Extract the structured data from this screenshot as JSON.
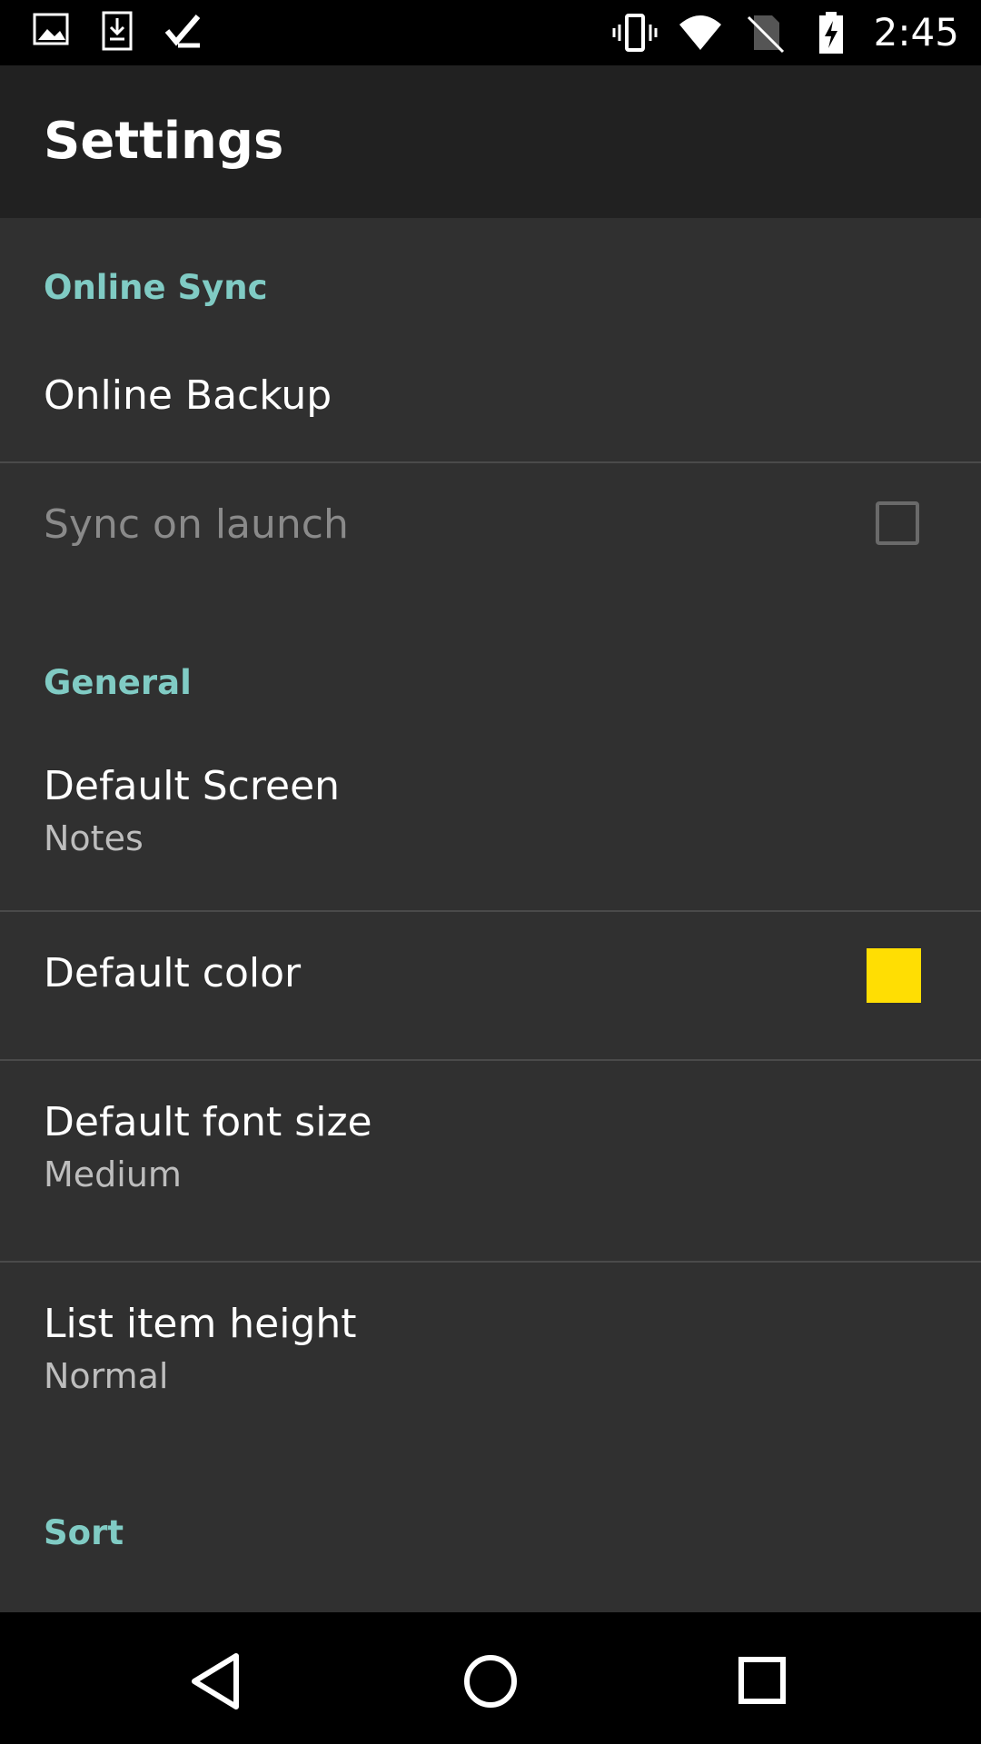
{
  "status_bar": {
    "time": "2:45",
    "left_icons": [
      "image-icon",
      "download-icon",
      "checklist-icon"
    ],
    "right_icons": [
      "vibrate-icon",
      "wifi-icon",
      "no-sim-icon",
      "battery-charging-icon"
    ]
  },
  "app_bar": {
    "title": "Settings"
  },
  "sections": {
    "online_sync": {
      "header": "Online Sync",
      "online_backup": {
        "title": "Online Backup"
      },
      "sync_on_launch": {
        "title": "Sync on launch",
        "checked": false,
        "enabled": false
      }
    },
    "general": {
      "header": "General",
      "default_screen": {
        "title": "Default Screen",
        "summary": "Notes"
      },
      "default_color": {
        "title": "Default color",
        "swatch_color": "#ffde03"
      },
      "default_font_size": {
        "title": "Default font size",
        "summary": "Medium"
      },
      "list_item_height": {
        "title": "List item height",
        "summary": "Normal"
      }
    },
    "sort": {
      "header": "Sort"
    }
  },
  "nav_bar": {
    "icons": [
      "back-icon",
      "home-icon",
      "recents-icon"
    ]
  },
  "colors": {
    "accent": "#80cbc4",
    "background": "#303030",
    "app_bar": "#212121",
    "status_bar": "#000000"
  }
}
